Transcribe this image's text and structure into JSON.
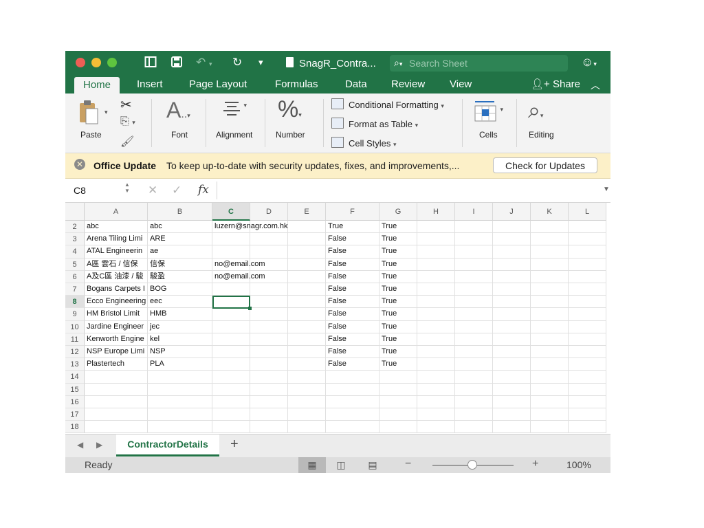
{
  "window": {
    "doc_title": "SnagR_Contra...",
    "search_placeholder": "Search Sheet"
  },
  "tabs": [
    "Home",
    "Insert",
    "Page Layout",
    "Formulas",
    "Data",
    "Review",
    "View"
  ],
  "share_label": "Share",
  "ribbon": {
    "paste": "Paste",
    "font": "Font",
    "alignment": "Alignment",
    "number": "Number",
    "conditional_formatting": "Conditional Formatting",
    "format_as_table": "Format as Table",
    "cell_styles": "Cell Styles",
    "cells": "Cells",
    "editing": "Editing"
  },
  "notification": {
    "title": "Office Update",
    "message": "To keep up-to-date with security updates, fixes, and improvements,...",
    "button": "Check for Updates"
  },
  "formula_bar": {
    "name_box": "C8",
    "fx": "fx",
    "content": ""
  },
  "grid": {
    "columns": [
      "A",
      "B",
      "C",
      "D",
      "E",
      "F",
      "G",
      "H",
      "I",
      "J",
      "K",
      "L"
    ],
    "selected_column": "C",
    "selected_row": 8,
    "rows": [
      {
        "n": 2,
        "A": "abc",
        "B": "abc",
        "C": "luzern@snagr.com.hk",
        "F": "True",
        "G": "True"
      },
      {
        "n": 3,
        "A": "Arena Tiling Limi",
        "B": "ARE",
        "C": "",
        "F": "False",
        "G": "True"
      },
      {
        "n": 4,
        "A": "ATAL Engineerin",
        "B": "ae",
        "C": "",
        "F": "False",
        "G": "True"
      },
      {
        "n": 5,
        "A": "A區 雲石 / 信保",
        "B": "信保",
        "C": "no@email.com",
        "F": "False",
        "G": "True"
      },
      {
        "n": 6,
        "A": "A及C區 油漆 / 駿",
        "B": "駿盈",
        "C": "no@email.com",
        "F": "False",
        "G": "True"
      },
      {
        "n": 7,
        "A": "Bogans Carpets I",
        "B": "BOG",
        "C": "",
        "F": "False",
        "G": "True"
      },
      {
        "n": 8,
        "A": "Ecco Engineering",
        "B": "eec",
        "C": "",
        "F": "False",
        "G": "True"
      },
      {
        "n": 9,
        "A": "HM Bristol Limit",
        "B": "HMB",
        "C": "",
        "F": "False",
        "G": "True"
      },
      {
        "n": 10,
        "A": "Jardine Engineer",
        "B": "jec",
        "C": "",
        "F": "False",
        "G": "True"
      },
      {
        "n": 11,
        "A": "Kenworth Engine",
        "B": "kel",
        "C": "",
        "F": "False",
        "G": "True"
      },
      {
        "n": 12,
        "A": "NSP Europe Limi",
        "B": "NSP",
        "C": "",
        "F": "False",
        "G": "True"
      },
      {
        "n": 13,
        "A": "Plastertech",
        "B": "PLA",
        "C": "",
        "F": "False",
        "G": "True"
      },
      {
        "n": 14
      },
      {
        "n": 15
      },
      {
        "n": 16
      },
      {
        "n": 17
      },
      {
        "n": 18
      }
    ]
  },
  "sheet_tab": "ContractorDetails",
  "status": {
    "ready": "Ready",
    "zoom": "100%"
  },
  "colors": {
    "accent": "#217346",
    "notification_bg": "#fcf0c8"
  },
  "icons": [
    "sidebar-icon",
    "save-icon",
    "undo-icon",
    "redo-icon",
    "customize-icon",
    "search-icon",
    "smiley-icon",
    "share-icon",
    "chevron-up-icon",
    "paste-icon",
    "cut-icon",
    "copy-icon",
    "format-painter-icon",
    "font-icon",
    "alignment-icon",
    "number-icon",
    "cells-icon",
    "editing-icon",
    "close-circle-icon",
    "fx-icon",
    "cancel-icon",
    "confirm-icon"
  ]
}
